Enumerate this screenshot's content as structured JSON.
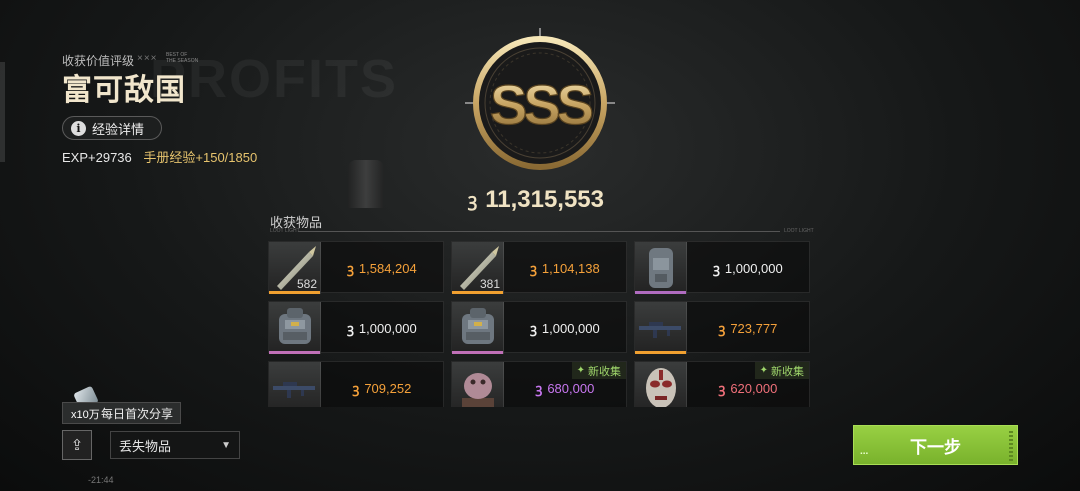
{
  "header": {
    "grade_label": "收获价值评级",
    "grade_title": "富可敌国",
    "deco_mark": "×××",
    "deco_small_1": "BEST OF",
    "deco_small_2": "THE SEASON",
    "bg_word": "PROFITS",
    "exp_button_label": "经验详情",
    "exp_value": "EXP+29736",
    "handbook_exp": "手册经验+150/1850"
  },
  "emblem": {
    "rank": "SSS"
  },
  "total": {
    "value": "11,315,553",
    "currency_icon": "coin-icon"
  },
  "loot": {
    "title": "收获物品",
    "sub_left": "LOOT LIGHT",
    "sub_right": "LOOT LIGHT",
    "items": [
      {
        "kind": "ammo-icon",
        "qty": "582",
        "value": "1,584,204",
        "value_color": "#f5a13a",
        "strip": "#f0a030",
        "tag": ""
      },
      {
        "kind": "ammo-icon",
        "qty": "381",
        "value": "1,104,138",
        "value_color": "#f5a13a",
        "strip": "#f0a030",
        "tag": ""
      },
      {
        "kind": "armor-vest-icon",
        "qty": "",
        "value": "1,000,000",
        "value_color": "#f0f0f0",
        "strip": "#b06cc0",
        "tag": ""
      },
      {
        "kind": "backpack-icon",
        "qty": "",
        "value": "1,000,000",
        "value_color": "#f0f0f0",
        "strip": "#c070b8",
        "tag": ""
      },
      {
        "kind": "backpack-icon",
        "qty": "",
        "value": "1,000,000",
        "value_color": "#f0f0f0",
        "strip": "#c070b8",
        "tag": ""
      },
      {
        "kind": "rifle-icon",
        "qty": "",
        "value": "723,777",
        "value_color": "#f5a13a",
        "strip": "#f0a030",
        "tag": ""
      },
      {
        "kind": "rifle-icon",
        "qty": "",
        "value": "709,252",
        "value_color": "#f5a13a",
        "strip": "#f0a030",
        "tag": ""
      },
      {
        "kind": "statue-icon",
        "qty": "",
        "value": "680,000",
        "value_color": "#c877f0",
        "strip": "#b06cc0",
        "tag": "新收集"
      },
      {
        "kind": "mask-icon",
        "qty": "",
        "value": "620,000",
        "value_color": "#f0707a",
        "strip": "#d05060",
        "tag": "新收集"
      }
    ]
  },
  "footer": {
    "share_multiplier": "x10万",
    "share_label": "每日首次分享",
    "select_value": "丢失物品",
    "timestamp": "-21:44",
    "next_label": "下一步",
    "next_dots": "..."
  },
  "colors": {
    "accent_gold": "#e6c36d",
    "next_green": "#8cc63f"
  }
}
